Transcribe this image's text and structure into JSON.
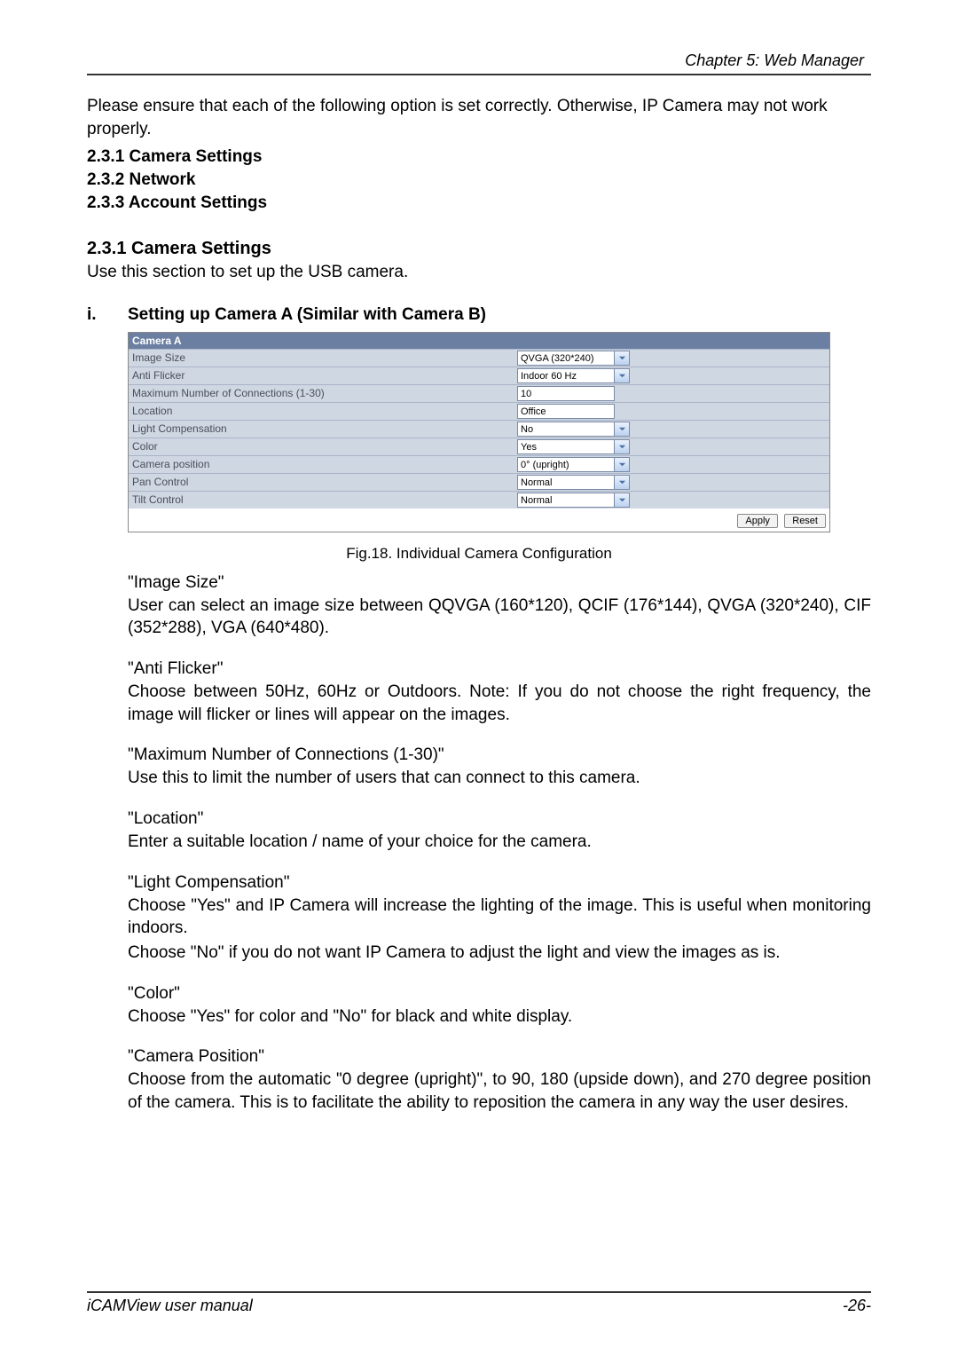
{
  "header": {
    "chapter": "Chapter 5: Web Manager"
  },
  "intro": {
    "l1": "Please ensure that each of the following option is set correctly. Otherwise, IP Camera may not work properly.",
    "items": [
      "2.3.1 Camera Settings",
      "2.3.2 Network",
      "2.3.3 Account Settings"
    ]
  },
  "sec231": {
    "title": "2.3.1 Camera Settings",
    "sub": "Use this section to set up the USB camera."
  },
  "roman_i": {
    "num": "i.",
    "title": "Setting up Camera A (Similar with Camera B)"
  },
  "shot": {
    "title": "Camera A",
    "rows": [
      {
        "label": "Image Size",
        "value": "QVGA (320*240)",
        "dropdown": true
      },
      {
        "label": "Anti Flicker",
        "value": "Indoor 60 Hz",
        "dropdown": true
      },
      {
        "label": "Maximum Number of Connections (1-30)",
        "value": "10",
        "dropdown": false
      },
      {
        "label": "Location",
        "value": "Office",
        "dropdown": false
      },
      {
        "label": "Light Compensation",
        "value": "No",
        "dropdown": true
      },
      {
        "label": "Color",
        "value": "Yes",
        "dropdown": true
      },
      {
        "label": "Camera position",
        "value": "0° (upright)",
        "dropdown": true
      },
      {
        "label": "Pan Control",
        "value": "Normal",
        "dropdown": true
      },
      {
        "label": "Tilt Control",
        "value": "Normal",
        "dropdown": true
      }
    ],
    "apply": "Apply",
    "reset": "Reset"
  },
  "figcap": "Fig.18.  Individual Camera Configuration",
  "paras": {
    "p1_t": "\"Image Size\"",
    "p1_b": "User can select an image size between QQVGA (160*120), QCIF (176*144), QVGA (320*240), CIF (352*288), VGA (640*480).",
    "p2_t": "\"Anti Flicker\"",
    "p2_b": "Choose between 50Hz, 60Hz or Outdoors. Note: If you do not choose the right frequency, the image will flicker or lines will appear on the images.",
    "p3_t": "\"Maximum Number of Connections (1-30)\"",
    "p3_b": "Use this to limit the number of users that can connect to this camera.",
    "p4_t": "\"Location\"",
    "p4_b": "Enter a suitable location / name of your choice for the camera.",
    "p5_t": "\"Light Compensation\"",
    "p5_b1": "Choose \"Yes\" and IP Camera will increase the lighting of the image. This is useful when monitoring indoors.",
    "p5_b2": "Choose \"No\" if you do not want IP Camera to adjust the light and view the images as is.",
    "p6_t": "\"Color\"",
    "p6_b": "Choose \"Yes\" for color and \"No\" for black and white display.",
    "p7_t": "\"Camera Position\"",
    "p7_b": "Choose from the automatic \"0 degree (upright)\", to 90, 180 (upside down), and 270 degree position of the camera. This is to facilitate the ability to reposition the camera in any way the user desires."
  },
  "footer": {
    "left": "iCAMView  user  manual",
    "right": "-26-"
  }
}
